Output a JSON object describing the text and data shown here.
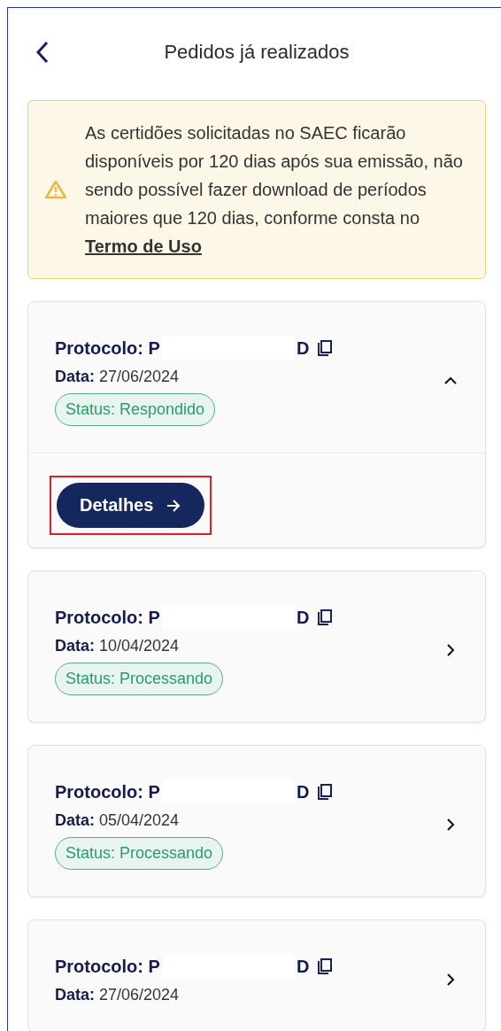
{
  "header": {
    "title": "Pedidos já realizados"
  },
  "notice": {
    "text": "As certidões solicitadas no SAEC ficarão disponíveis por 120 dias após sua emissão, não sendo possível fazer download de períodos maiores que 120 dias, conforme consta no",
    "link": "Termo de Uso"
  },
  "orders": [
    {
      "protocol_label": "Protocolo:",
      "protocol_start": "P",
      "protocol_end": "D",
      "date_label": "Data:",
      "date": "27/06/2024",
      "status": "Status: Respondido",
      "expanded": true,
      "action": {
        "label": "Detalhes",
        "highlighted": true
      }
    },
    {
      "protocol_label": "Protocolo:",
      "protocol_start": "P",
      "protocol_end": "D",
      "date_label": "Data:",
      "date": "10/04/2024",
      "status": "Status: Processando",
      "expanded": false
    },
    {
      "protocol_label": "Protocolo:",
      "protocol_start": "P",
      "protocol_end": "D",
      "date_label": "Data:",
      "date": "05/04/2024",
      "status": "Status: Processando",
      "expanded": false
    },
    {
      "protocol_label": "Protocolo:",
      "protocol_start": "P",
      "protocol_end": "D",
      "date_label": "Data:",
      "date": "27/06/2024",
      "expanded": false
    }
  ]
}
